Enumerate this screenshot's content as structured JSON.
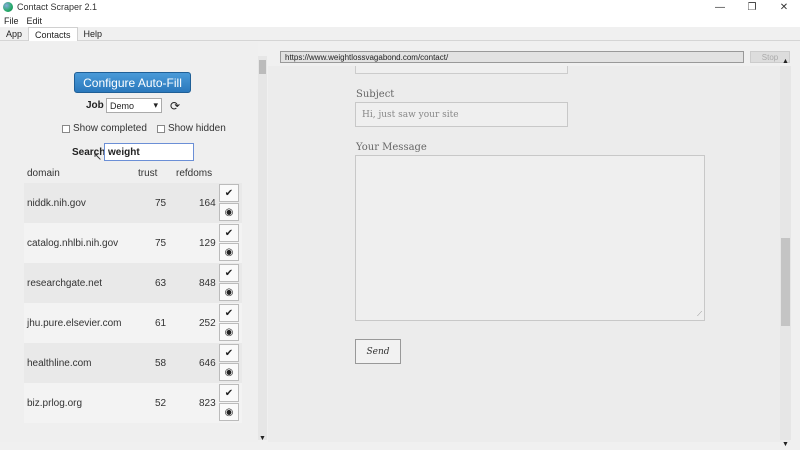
{
  "window": {
    "title": "Contact Scraper 2.1",
    "controls": [
      "—",
      "❐",
      "✕"
    ]
  },
  "menu": {
    "items": [
      "File",
      "Edit"
    ]
  },
  "tabs": [
    {
      "label": "App",
      "active": false
    },
    {
      "label": "Contacts",
      "active": true
    },
    {
      "label": "Help",
      "active": false
    }
  ],
  "left": {
    "configure_label": "Configure Auto-Fill",
    "job_label": "Job",
    "job_value": "Demo",
    "show_completed": "Show completed",
    "show_hidden": "Show hidden",
    "search_label": "Search",
    "search_value": "weight",
    "columns": {
      "domain": "domain",
      "trust": "trust",
      "refdoms": "refdoms"
    },
    "rows": [
      {
        "domain": "niddk.nih.gov",
        "trust": "75",
        "refdoms": "164"
      },
      {
        "domain": "catalog.nhlbi.nih.gov",
        "trust": "75",
        "refdoms": "129"
      },
      {
        "domain": "researchgate.net",
        "trust": "63",
        "refdoms": "848"
      },
      {
        "domain": "jhu.pure.elsevier.com",
        "trust": "61",
        "refdoms": "252"
      },
      {
        "domain": "healthline.com",
        "trust": "58",
        "refdoms": "646"
      },
      {
        "domain": "biz.prlog.org",
        "trust": "52",
        "refdoms": "823"
      }
    ]
  },
  "right": {
    "url": "https://www.weightlossvagabond.com/contact/",
    "stop_label": "Stop",
    "subject_label": "Subject",
    "subject_value": "Hi, just saw your site",
    "message_label": "Your Message",
    "send_label": "Send"
  }
}
